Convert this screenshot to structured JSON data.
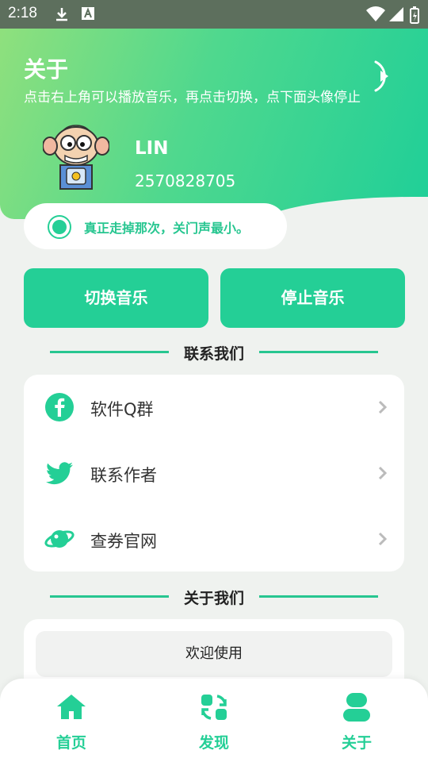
{
  "status_bar": {
    "time": "2:18"
  },
  "header": {
    "title": "关于",
    "subtitle": "点击右上角可以播放音乐，再点击切换，点下面头像停止",
    "user_name": "LIN",
    "user_id": "2570828705"
  },
  "quote": {
    "text": "真正走掉那次，关门声最小。"
  },
  "buttons": {
    "switch_music": "切换音乐",
    "stop_music": "停止音乐"
  },
  "contact": {
    "heading": "联系我们",
    "items": [
      {
        "label": "软件Q群",
        "icon": "facebook-icon"
      },
      {
        "label": "联系作者",
        "icon": "twitter-icon"
      },
      {
        "label": "查券官网",
        "icon": "planet-icon"
      }
    ]
  },
  "about": {
    "heading": "关于我们",
    "welcome": "欢迎使用"
  },
  "nav": {
    "home": "首页",
    "discover": "发现",
    "about": "关于"
  },
  "colors": {
    "accent": "#24cf96",
    "gradient_start": "#8fe07d",
    "gradient_end": "#1fcf98",
    "background": "#eff2ef"
  }
}
